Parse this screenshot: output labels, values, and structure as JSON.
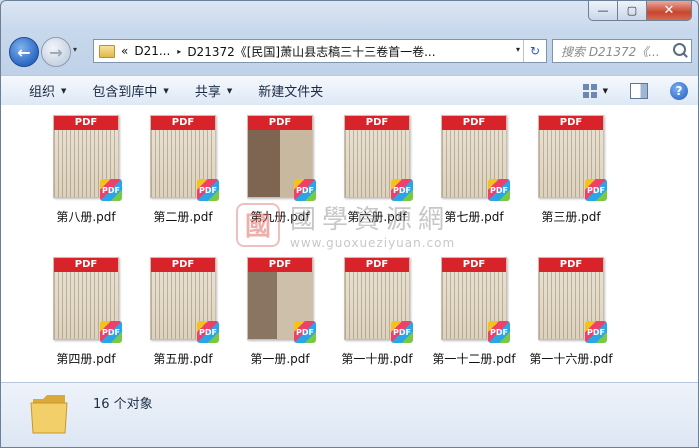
{
  "window": {
    "minimize_glyph": "—",
    "maximize_glyph": "▢",
    "close_glyph": "✕"
  },
  "nav": {
    "back_glyph": "←",
    "forward_glyph": "→",
    "history_glyph": "▾"
  },
  "address": {
    "breadcrumb_prefix": "«",
    "segment1": "D21...",
    "segment2": "D21372《[民国]萧山县志稿三十三卷首一卷...",
    "separator_glyph": "▸",
    "dropdown_glyph": "▾",
    "refresh_glyph": "↻"
  },
  "search": {
    "placeholder": "搜索 D21372《..."
  },
  "toolbar": {
    "organize": "组织",
    "include_library": "包含到库中",
    "share": "共享",
    "new_folder": "新建文件夹",
    "caret": "▼",
    "help": "?"
  },
  "files": [
    {
      "name": "第八册.pdf",
      "band": "PDF",
      "badge": "PDF"
    },
    {
      "name": "第二册.pdf",
      "band": "PDF",
      "badge": "PDF"
    },
    {
      "name": "第九册.pdf",
      "band": "PDF",
      "badge": "PDF"
    },
    {
      "name": "第六册.pdf",
      "band": "PDF",
      "badge": "PDF"
    },
    {
      "name": "第七册.pdf",
      "band": "PDF",
      "badge": "PDF"
    },
    {
      "name": "第三册.pdf",
      "band": "PDF",
      "badge": "PDF"
    },
    {
      "name": "第四册.pdf",
      "band": "PDF",
      "badge": "PDF"
    },
    {
      "name": "第五册.pdf",
      "band": "PDF",
      "badge": "PDF"
    },
    {
      "name": "第一册.pdf",
      "band": "PDF",
      "badge": "PDF"
    },
    {
      "name": "第一十册.pdf",
      "band": "PDF",
      "badge": "PDF"
    },
    {
      "name": "第一十二册.pdf",
      "band": "PDF",
      "badge": "PDF"
    },
    {
      "name": "第一十六册.pdf",
      "band": "PDF",
      "badge": "PDF"
    }
  ],
  "watermark": {
    "seal": "國",
    "chinese": "國學資源網",
    "url": "www.guoxueziyuan.com"
  },
  "status": {
    "count": "16 个对象"
  }
}
